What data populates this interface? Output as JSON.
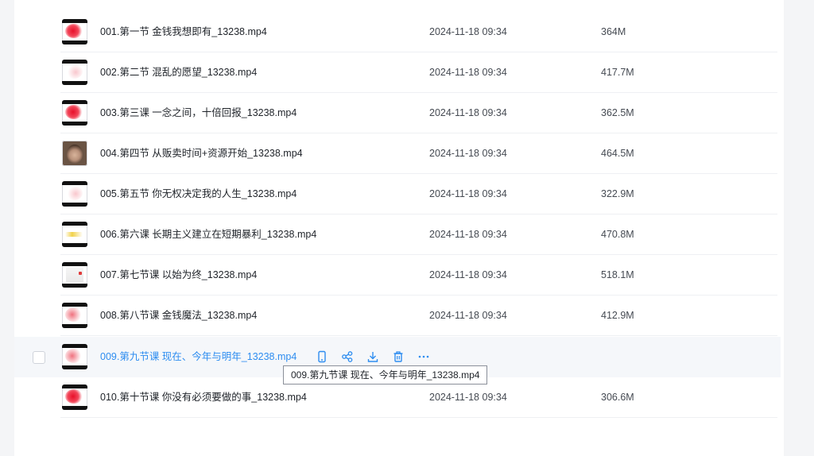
{
  "files": [
    {
      "name": "001.第一节 金钱我想即有_13238.mp4",
      "date": "2024-11-18 09:34",
      "size": "364M",
      "thumb": "red"
    },
    {
      "name": "002.第二节 混乱的愿望_13238.mp4",
      "date": "2024-11-18 09:34",
      "size": "417.7M",
      "thumb": "white"
    },
    {
      "name": "003.第三课 一念之间，十倍回报_13238.mp4",
      "date": "2024-11-18 09:34",
      "size": "362.5M",
      "thumb": "red"
    },
    {
      "name": "004.第四节 从贩卖时间+资源开始_13238.mp4",
      "date": "2024-11-18 09:34",
      "size": "464.5M",
      "thumb": "face"
    },
    {
      "name": "005.第五节 你无权决定我的人生_13238.mp4",
      "date": "2024-11-18 09:34",
      "size": "322.9M",
      "thumb": "white"
    },
    {
      "name": "006.第六课 长期主义建立在短期暴利_13238.mp4",
      "date": "2024-11-18 09:34",
      "size": "470.8M",
      "thumb": "yellow"
    },
    {
      "name": "007.第七节课 以始为终_13238.mp4",
      "date": "2024-11-18 09:34",
      "size": "518.1M",
      "thumb": "doc"
    },
    {
      "name": "008.第八节课 金钱魔法_13238.mp4",
      "date": "2024-11-18 09:34",
      "size": "412.9M",
      "thumb": "pink"
    },
    {
      "name": "009.第九节课 现在、今年与明年_13238.mp4",
      "date": "",
      "size": "",
      "thumb": "pink",
      "hovered": true
    },
    {
      "name": "010.第十节课 你没有必须要做的事_13238.mp4",
      "date": "2024-11-18 09:34",
      "size": "306.6M",
      "thumb": "red"
    }
  ],
  "row_actions": [
    "phone-icon",
    "share-icon",
    "download-icon",
    "delete-icon",
    "more-icon"
  ],
  "tooltip": {
    "text": "009.第九节课 现在、今年与明年_13238.mp4"
  },
  "colors": {
    "accent": "#2e8df0",
    "hover_row": "#f5f7fa",
    "text": "#1f2329"
  }
}
